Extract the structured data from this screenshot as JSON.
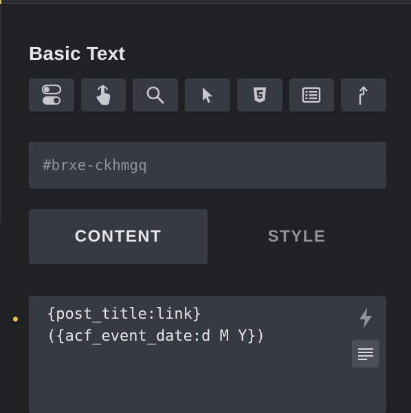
{
  "panel": {
    "title": "Basic Text"
  },
  "toolbar": {
    "buttons": [
      {
        "icon": "toggle-icon"
      },
      {
        "icon": "pointer-hand-icon"
      },
      {
        "icon": "search-icon"
      },
      {
        "icon": "cursor-arrow-icon"
      },
      {
        "icon": "css3-icon"
      },
      {
        "icon": "list-table-icon"
      },
      {
        "icon": "arrow-up-icon"
      }
    ]
  },
  "element_id": {
    "value": "#brxe-ckhmgq"
  },
  "tabs": {
    "content_label": "CONTENT",
    "style_label": "STYLE",
    "active": "content"
  },
  "editor": {
    "line1": "{post_title:link}",
    "line2": "({acf_event_date:d M Y})",
    "dynamic_data_icon": "bolt-icon",
    "toggle_editor_icon": "text-lines-icon"
  },
  "colors": {
    "background": "#1f2124",
    "control": "#363a41",
    "text_primary": "#e4e6e9",
    "text_muted": "#8d939b",
    "indicator": "#f0c43c"
  }
}
